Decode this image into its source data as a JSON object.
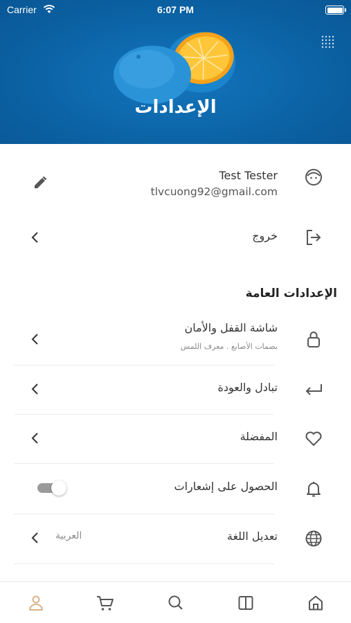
{
  "status_bar": {
    "carrier": "Carrier",
    "time": "6:07 PM"
  },
  "header": {
    "title": "الإعدادات",
    "menu_icon": "grid-dots-icon"
  },
  "profile": {
    "name": "Test Tester",
    "email": "tlvcuong92@gmail.com",
    "avatar_icon": "smiley-face-icon",
    "edit_icon": "pencil-icon"
  },
  "logout": {
    "label": "خروج",
    "icon": "logout-icon"
  },
  "general_settings": {
    "title": "الإعدادات العامة",
    "items": [
      {
        "label": "شاشة القفل والأمان",
        "subtitle": "بصمات الأصابع . معرف اللمس",
        "icon": "lock-icon"
      },
      {
        "label": "تبادل والعودة",
        "icon": "return-arrow-icon"
      },
      {
        "label": "المفضلة",
        "icon": "heart-icon"
      },
      {
        "label": "الحصول على إشعارات",
        "icon": "bell-icon",
        "toggle": "off"
      },
      {
        "label": "تعديل اللغة",
        "value": "العربية",
        "icon": "globe-icon"
      }
    ]
  },
  "tab_bar": {
    "tabs": [
      {
        "icon": "user-icon",
        "active": true
      },
      {
        "icon": "cart-icon"
      },
      {
        "icon": "search-icon"
      },
      {
        "icon": "book-icon"
      },
      {
        "icon": "home-icon"
      }
    ]
  },
  "colors": {
    "header_blue": "#0c66aa",
    "active_tab": "#d8b48a",
    "icon_gray": "#555555"
  }
}
